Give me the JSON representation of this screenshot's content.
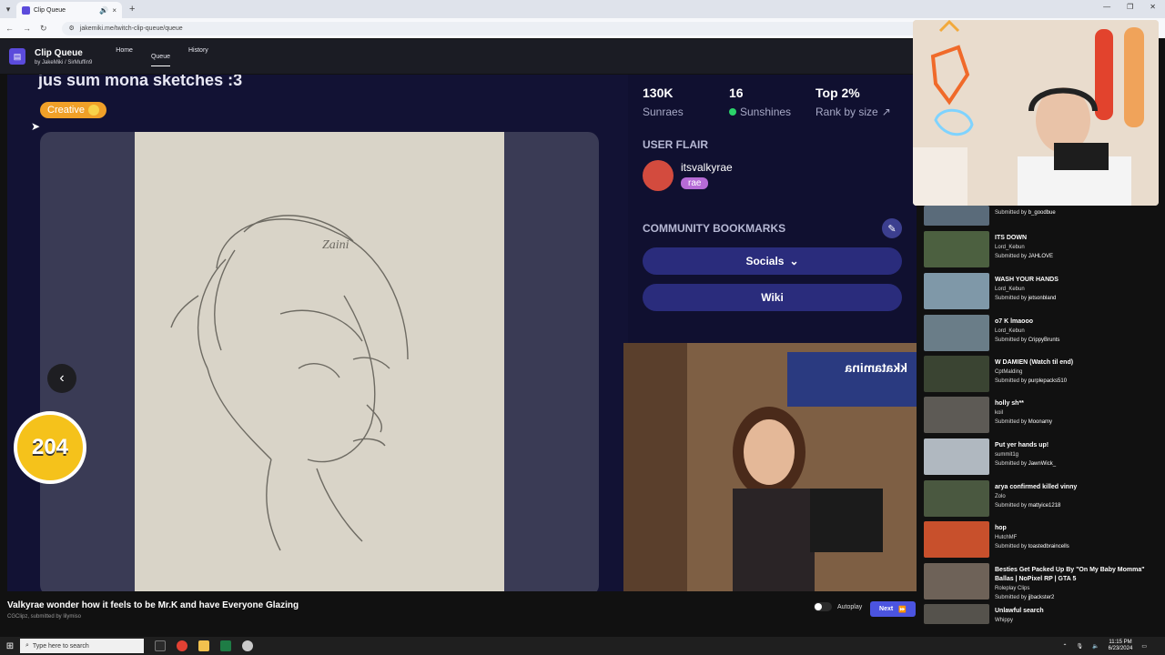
{
  "browser": {
    "tab_title": "Clip Queue",
    "url": "jakemiki.me/twitch-clip-queue/queue"
  },
  "app": {
    "name": "Clip Queue",
    "by_prefix": "by",
    "author1": "JakeMiki",
    "separator": "/",
    "author2": "SirMuffin9",
    "nav": [
      "Home",
      "Queue",
      "History"
    ]
  },
  "clip_view": {
    "top_title": "jus sum mona sketches :3",
    "category_badge": "Creative",
    "counter": "204",
    "stats": [
      {
        "value": "130K",
        "label": "Sunraes"
      },
      {
        "value": "16",
        "label": "Sunshines"
      },
      {
        "value": "Top 2%",
        "label": "Rank by size"
      }
    ],
    "user_flair_heading": "USER FLAIR",
    "flair_user": "itsvalkyrae",
    "flair_tag": "rae",
    "bookmarks_heading": "COMMUNITY BOOKMARKS",
    "socials_label": "Socials",
    "wiki_label": "Wiki",
    "signature_text": "Zaini",
    "sign_text": "kkatamina"
  },
  "current_clip": {
    "title": "Valkyrae wonder how it feels to be Mr.K and have Everyone Glazing",
    "subtitle": "CGClipz, submitted by lilymiso",
    "autoplay_label": "Autoplay",
    "next_label": "Next"
  },
  "queue": [
    {
      "title": "",
      "author": "",
      "submitter": "b_goodbue",
      "color": "#5a6b7a"
    },
    {
      "title": "ITS DOWN",
      "author": "Lord_Kebun",
      "submitter": "JAHLOVE",
      "color": "#4c6040"
    },
    {
      "title": "WASH YOUR HANDS",
      "author": "Lord_Kebun",
      "submitter": "jetsonbland",
      "color": "#7f98a8"
    },
    {
      "title": "o7 K lmaooo",
      "author": "Lord_Kebun",
      "submitter": "CrippyBrunts",
      "color": "#6a7d88"
    },
    {
      "title": "W DAMIEN (Watch til end)",
      "author": "CptMalding",
      "submitter": "purplepacks510",
      "color": "#3a4432"
    },
    {
      "title": "holly sh**",
      "author": "koil",
      "submitter": "Moonamy",
      "color": "#5d5a55"
    },
    {
      "title": "Put yer hands up!",
      "author": "summit1g",
      "submitter": "JawnWick_",
      "color": "#b0b8c0"
    },
    {
      "title": "arya confirmed killed vinny",
      "author": "Zolo",
      "submitter": "mattyice1218",
      "color": "#4a5840"
    },
    {
      "title": "hop",
      "author": "HutchMF",
      "submitter": "toastedbraincells",
      "color": "#c8502c"
    },
    {
      "title": "Besties Get Packed Up By \"On My Baby Momma\" Ballas | NoPixel RP | GTA 5",
      "author": "Roleplay Clips",
      "submitter": "jjbackster2",
      "color": "#6e6258"
    },
    {
      "title": "Unlawful search",
      "author": "Whippy",
      "submitter": "",
      "color": "#55524c"
    }
  ],
  "submitted_by_label": "Submitted by",
  "taskbar": {
    "search_placeholder": "Type here to search",
    "time": "11:15 PM",
    "date": "6/23/2024"
  }
}
